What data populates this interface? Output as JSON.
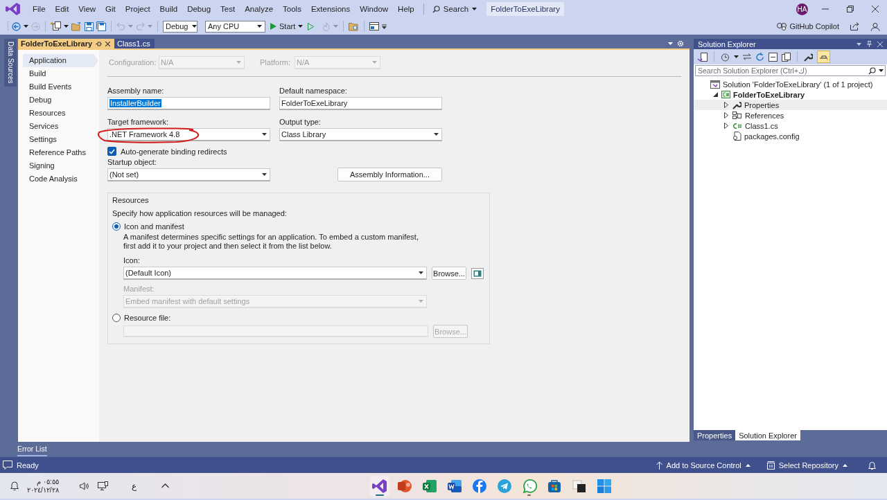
{
  "menu": {
    "items": [
      "File",
      "Edit",
      "View",
      "Git",
      "Project",
      "Build",
      "Debug",
      "Test",
      "Analyze",
      "Tools",
      "Extensions",
      "Window",
      "Help"
    ],
    "search": "Search",
    "solution_badge": "FolderToExeLibrary",
    "avatar": "HA"
  },
  "toolbar": {
    "configuration": "Debug",
    "platform": "Any CPU",
    "start": "Start",
    "copilot": "GitHub Copilot"
  },
  "side_tab": "Data Sources",
  "doc_tabs": [
    {
      "label": "FolderToExeLibrary",
      "selected": true
    },
    {
      "label": "Class1.cs",
      "selected": false
    }
  ],
  "pages": [
    {
      "label": "Application",
      "selected": true
    },
    {
      "label": "Build",
      "selected": false
    },
    {
      "label": "Build Events",
      "selected": false
    },
    {
      "label": "Debug",
      "selected": false
    },
    {
      "label": "Resources",
      "selected": false
    },
    {
      "label": "Services",
      "selected": false
    },
    {
      "label": "Settings",
      "selected": false
    },
    {
      "label": "Reference Paths",
      "selected": false
    },
    {
      "label": "Signing",
      "selected": false
    },
    {
      "label": "Code Analysis",
      "selected": false
    }
  ],
  "form": {
    "configuration": {
      "label": "Configuration:",
      "value": "N/A",
      "disabled": true
    },
    "platform": {
      "label": "Platform:",
      "value": "N/A",
      "disabled": true
    },
    "assembly_name": {
      "label": "Assembly name:",
      "value": "InstallerBuilder",
      "highlighted": true
    },
    "default_namespace": {
      "label": "Default namespace:",
      "value": "FolderToExeLibrary",
      "highlighted": false
    },
    "target_framework": {
      "label": "Target framework:",
      "value": ".NET Framework 4.8",
      "circled": true
    },
    "output_type": {
      "label": "Output type:",
      "value": "Class Library"
    },
    "binding_redirects": {
      "label": "Auto-generate binding redirects",
      "checked": true
    },
    "startup_object": {
      "label": "Startup object:",
      "value": "(Not set)"
    },
    "assembly_info_button": "Assembly Information...",
    "resources": {
      "title": "Resources",
      "description": "Specify how application resources will be managed:",
      "options": [
        {
          "label": "Icon and manifest",
          "selected": true,
          "description": "A manifest determines specific settings for an application. To embed a custom manifest, first add it to your project and then select it from the list below."
        },
        {
          "label": "Resource file:",
          "selected": false
        }
      ],
      "icon": {
        "label": "Icon:",
        "value": "(Default Icon)",
        "disabled": false
      },
      "icon_browse": {
        "label": "Browse...",
        "disabled": false
      },
      "manifest": {
        "label": "Manifest:",
        "value": "Embed manifest with default settings",
        "disabled": true
      },
      "resource_browse": {
        "label": "Browse...",
        "disabled": true
      }
    }
  },
  "solution_explorer": {
    "title": "Solution Explorer",
    "search_placeholder": "Search Solution Explorer (Ctrl+ك)",
    "tree": [
      {
        "label": "Solution 'FolderToExeLibrary' (1 of 1 project)",
        "kind": "solution",
        "expandable": false,
        "selected": false,
        "children": [
          {
            "label": "FolderToExeLibrary",
            "kind": "project",
            "expandable": true,
            "expanded": true,
            "selected": false,
            "children": [
              {
                "label": "Properties",
                "kind": "wrench",
                "expandable": true,
                "expanded": false,
                "selected": true
              },
              {
                "label": "References",
                "kind": "references",
                "expandable": true,
                "expanded": false,
                "selected": false
              },
              {
                "label": "Class1.cs",
                "kind": "csfile",
                "expandable": true,
                "expanded": false,
                "selected": false
              },
              {
                "label": "packages.config",
                "kind": "config",
                "expandable": false,
                "selected": false
              }
            ]
          }
        ]
      }
    ],
    "bottom_tabs": [
      {
        "label": "Properties",
        "selected": false
      },
      {
        "label": "Solution Explorer",
        "selected": true
      }
    ]
  },
  "error_list": "Error List",
  "status": {
    "text": "Ready",
    "source_control": "Add to Source Control",
    "repository": "Select Repository"
  },
  "taskbar": {
    "time": "٠٥:٥٥ م",
    "date": "٢٠٢٤/١٢/٢٨",
    "language": "ع",
    "apps": [
      {
        "kind": "ribbon",
        "active": true,
        "running": true
      },
      {
        "kind": "slides",
        "active": false,
        "running": false
      },
      {
        "kind": "sheet",
        "active": false,
        "running": false
      },
      {
        "kind": "doc",
        "active": false,
        "running": false
      },
      {
        "kind": "social",
        "active": false,
        "running": false
      },
      {
        "kind": "plane",
        "active": false,
        "running": false
      },
      {
        "kind": "chat",
        "active": false,
        "running": true
      },
      {
        "kind": "store",
        "active": false,
        "running": false
      },
      {
        "kind": "squares",
        "active": false,
        "running": false
      },
      {
        "kind": "start",
        "active": false,
        "running": false
      }
    ]
  }
}
